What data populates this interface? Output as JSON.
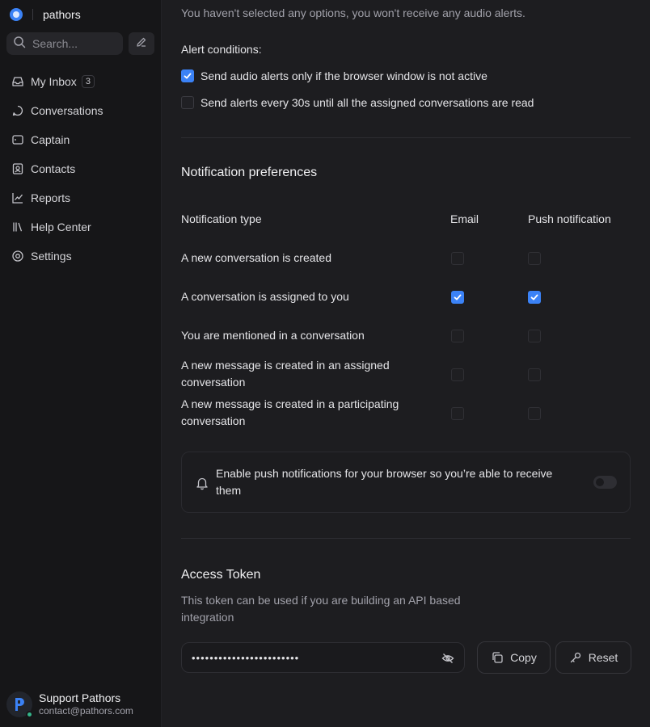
{
  "brand": {
    "name": "pathors"
  },
  "search": {
    "placeholder": "Search..."
  },
  "nav": [
    {
      "label": "My Inbox",
      "badge": "3",
      "icon": "inbox-icon"
    },
    {
      "label": "Conversations",
      "icon": "chat-icon"
    },
    {
      "label": "Captain",
      "icon": "captain-icon"
    },
    {
      "label": "Contacts",
      "icon": "contacts-icon"
    },
    {
      "label": "Reports",
      "icon": "reports-icon"
    },
    {
      "label": "Help Center",
      "icon": "library-icon"
    },
    {
      "label": "Settings",
      "icon": "settings-icon"
    }
  ],
  "profile": {
    "name": "Support Pathors",
    "email": "contact@pathors.com",
    "status_color": "#34b48a"
  },
  "audio": {
    "no_selection_text": "You haven't selected any options, you won't receive any audio alerts.",
    "conditions_label": "Alert conditions:",
    "conditions": [
      {
        "label": "Send audio alerts only if the browser window is not active",
        "checked": true
      },
      {
        "label": "Send alerts every 30s until all the assigned conversations are read",
        "checked": false
      }
    ]
  },
  "notifications": {
    "title": "Notification preferences",
    "col_type": "Notification type",
    "col_email": "Email",
    "col_push": "Push notification",
    "rows": [
      {
        "label": "A new conversation is created",
        "email": false,
        "push": false
      },
      {
        "label": "A conversation is assigned to you",
        "email": true,
        "push": true
      },
      {
        "label": "You are mentioned in a conversation",
        "email": false,
        "push": false
      },
      {
        "label": "A new message is created in an assigned conversation",
        "email": false,
        "push": false
      },
      {
        "label": "A new message is created in a participating conversation",
        "email": false,
        "push": false
      }
    ],
    "push_card_text": "Enable push notifications for your browser so you’re able to receive them",
    "push_enabled": false
  },
  "access_token": {
    "title": "Access Token",
    "description": "This token can be used if you are building an API based integration",
    "masked_value": "••••••••••••••••••••••••",
    "copy_label": "Copy",
    "reset_label": "Reset"
  },
  "colors": {
    "accent": "#3b82f6",
    "background": "#1d1d20",
    "sidebar": "#161618"
  }
}
